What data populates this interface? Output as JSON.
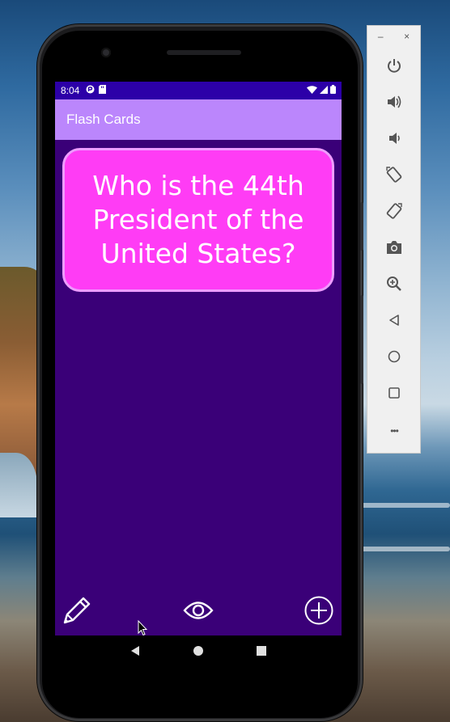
{
  "status_bar": {
    "time": "8:04"
  },
  "app": {
    "title": "Flash Cards"
  },
  "card": {
    "question": "Who is the 44th President of the United States?"
  },
  "bottom_actions": [
    {
      "icon": "pencil-icon",
      "label": "edit"
    },
    {
      "icon": "eye-icon",
      "label": "reveal"
    },
    {
      "icon": "add-circle-icon",
      "label": "add"
    }
  ],
  "emulator_toolbar": {
    "minimize": "–",
    "close": "×",
    "buttons": [
      "power-icon",
      "volume-up-icon",
      "volume-down-icon",
      "rotate-left-icon",
      "rotate-right-icon",
      "camera-icon",
      "zoom-icon",
      "back-icon",
      "home-icon",
      "overview-icon",
      "more-icon"
    ],
    "more_label": "•••"
  },
  "colors": {
    "status_bar": "#2c00a8",
    "app_bar": "#bb86fc",
    "screen_bg": "#3a0078",
    "card_bg": "#ff3cf5",
    "card_border": "#ee9cff"
  }
}
